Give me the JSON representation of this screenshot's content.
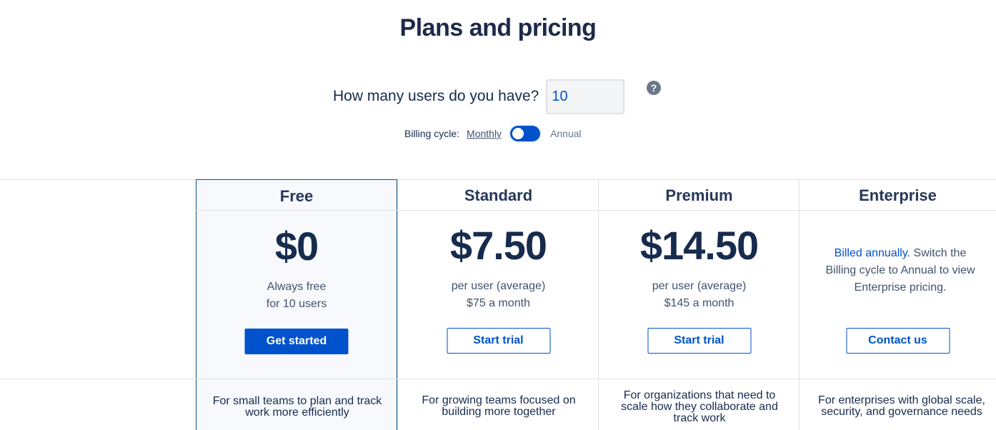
{
  "page": {
    "title": "Plans and pricing"
  },
  "users": {
    "label": "How many users do you have?",
    "value": "10",
    "help_icon": "question-circle-icon"
  },
  "billing": {
    "label": "Billing cycle:",
    "monthly": "Monthly",
    "annual": "Annual",
    "annual_selected": false
  },
  "plans": [
    {
      "name": "Free",
      "price": "$0",
      "line1": "Always free",
      "line2": "for 10 users",
      "button": "Get started",
      "description": "For small teams to plan and track work more efficiently"
    },
    {
      "name": "Standard",
      "price": "$7.50",
      "line1": "per user (average)",
      "line2": "$75 a month",
      "button": "Start trial",
      "description": "For growing teams focused on building more together"
    },
    {
      "name": "Premium",
      "price": "$14.50",
      "line1": "per user (average)",
      "line2": "$145 a month",
      "button": "Start trial",
      "description": "For organizations that need to scale how they collaborate and track work"
    },
    {
      "name": "Enterprise",
      "note_link": "Billed annually.",
      "note_text": " Switch the Billing cycle to Annual to view Enterprise pricing.",
      "button": "Contact us",
      "description": "For enterprises with global scale, security, and governance needs"
    }
  ],
  "colors": {
    "primary": "#0052cc",
    "heading": "#172b4d",
    "free_bg": "#f7f9fc"
  }
}
